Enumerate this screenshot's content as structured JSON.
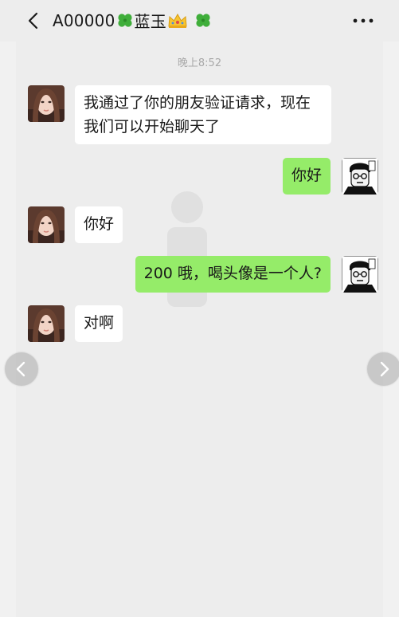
{
  "header": {
    "back_icon": "chevron-left-icon",
    "title_prefix": "A00000",
    "title_name": "蓝玉",
    "title_emojis": [
      "four-leaf-clover-icon",
      "crown-icon",
      "four-leaf-clover-icon"
    ],
    "more_icon": "more-dots-icon"
  },
  "timestamp": "晚上8:52",
  "messages": [
    {
      "side": "in",
      "lines": [
        "我通过了你的朋友验证请求，现在",
        "我们可以开始聊天了"
      ]
    },
    {
      "side": "out",
      "text": "你好"
    },
    {
      "side": "in",
      "text": "你好"
    },
    {
      "side": "out",
      "text": "200 哦，喝头像是一个人?"
    },
    {
      "side": "in",
      "text": "对啊"
    }
  ],
  "nav": {
    "prev_icon": "chevron-left-icon",
    "next_icon": "chevron-right-icon"
  },
  "colors": {
    "background": "#ededed",
    "incoming_bubble": "#ffffff",
    "outgoing_bubble": "#95ec69",
    "timestamp": "#a9a9a9"
  }
}
